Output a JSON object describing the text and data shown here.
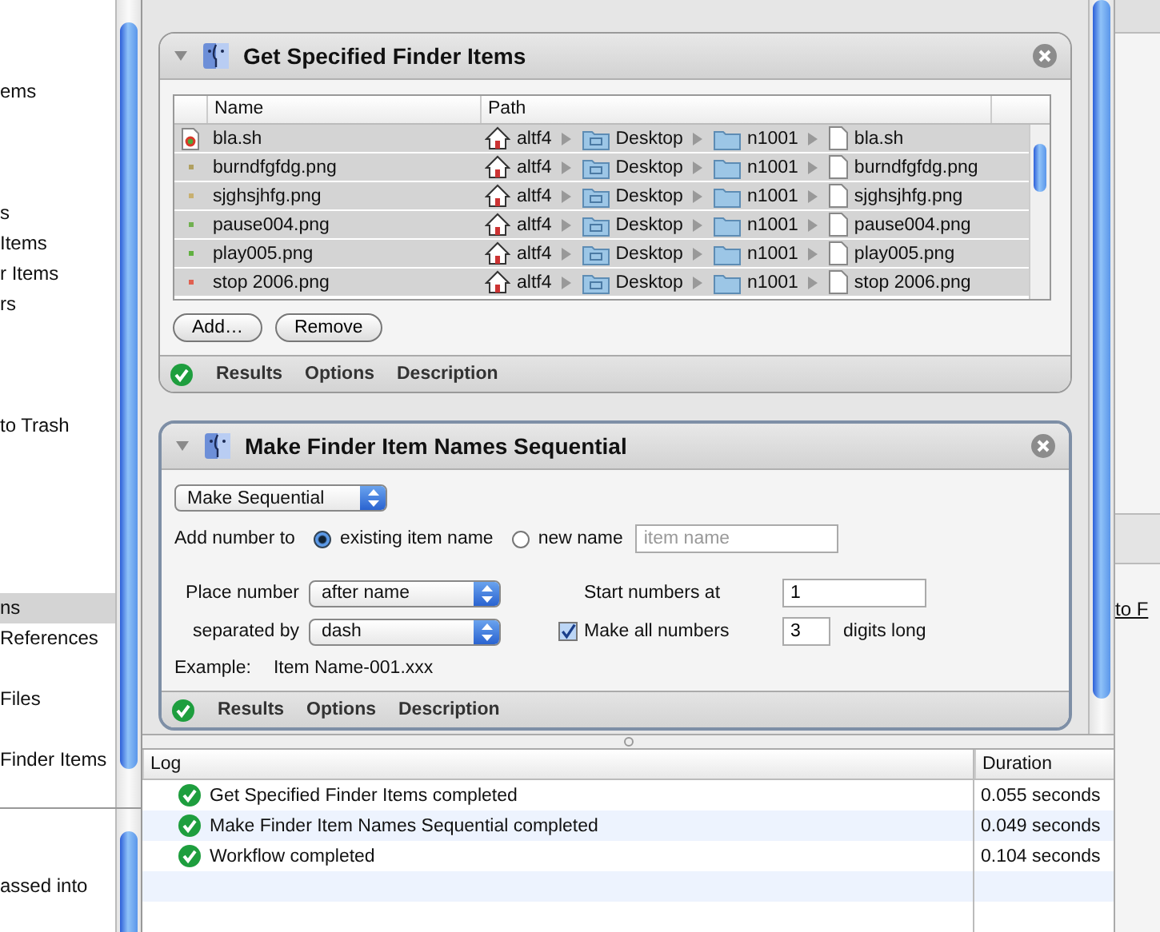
{
  "sidebar": {
    "items": [
      {
        "label": "ems",
        "selected": false
      },
      {
        "label": "s",
        "selected": false
      },
      {
        "label": "Items",
        "selected": false
      },
      {
        "label": "r Items",
        "selected": false
      },
      {
        "label": "rs",
        "selected": false
      },
      {
        "label": "to Trash",
        "selected": false
      },
      {
        "label": "ns",
        "selected": true
      },
      {
        "label": "References",
        "selected": false
      },
      {
        "label": "Files",
        "selected": false
      },
      {
        "label": "Finder Items",
        "selected": false
      }
    ],
    "description": "assed into"
  },
  "actions": [
    {
      "title": "Get Specified Finder Items",
      "expanded": true,
      "selected": false,
      "kind": "file_list",
      "table": {
        "columns": [
          "Name",
          "Path"
        ],
        "rows": [
          {
            "name": "bla.sh",
            "kind": "script",
            "selected": true,
            "path": [
              "altf4",
              "Desktop",
              "n1001",
              "bla.sh"
            ]
          },
          {
            "name": "burndfgfdg.png",
            "kind": "image",
            "color": "#b0a060",
            "selected": true,
            "path": [
              "altf4",
              "Desktop",
              "n1001",
              "burndfgfdg.png"
            ]
          },
          {
            "name": "sjghsjhfg.png",
            "kind": "image",
            "color": "#c8b070",
            "selected": true,
            "path": [
              "altf4",
              "Desktop",
              "n1001",
              "sjghsjhfg.png"
            ]
          },
          {
            "name": "pause004.png",
            "kind": "image",
            "color": "#70b050",
            "selected": true,
            "path": [
              "altf4",
              "Desktop",
              "n1001",
              "pause004.png"
            ]
          },
          {
            "name": "play005.png",
            "kind": "image",
            "color": "#60b040",
            "selected": true,
            "path": [
              "altf4",
              "Desktop",
              "n1001",
              "play005.png"
            ]
          },
          {
            "name": "stop 2006.png",
            "kind": "image",
            "color": "#e06050",
            "selected": true,
            "path": [
              "altf4",
              "Desktop",
              "n1001",
              "stop 2006.png"
            ]
          }
        ]
      },
      "buttons": [
        "Add…",
        "Remove"
      ],
      "footer": [
        "Results",
        "Options",
        "Description"
      ]
    },
    {
      "title": "Make Finder Item Names Sequential",
      "expanded": true,
      "selected": true,
      "kind": "rename",
      "mode": "Make Sequential",
      "add_number_label": "Add number to",
      "radios": [
        {
          "label": "existing item name",
          "selected": true
        },
        {
          "label": "new name",
          "selected": false
        }
      ],
      "new_name_placeholder": "item name",
      "place_label": "Place number",
      "place_value": "after name",
      "separator_label": "separated by",
      "separator_value": "dash",
      "start_label": "Start numbers at",
      "start_value": "1",
      "digits": {
        "checked": true,
        "label": "Make all numbers",
        "value": "3",
        "suffix": "digits long"
      },
      "example_label": "Example:",
      "example_value": "Item Name-001.xxx",
      "footer": [
        "Results",
        "Options",
        "Description"
      ]
    }
  ],
  "right_link": "to F",
  "log": {
    "columns": [
      "Log",
      "Duration"
    ],
    "rows": [
      {
        "text": "Get Specified Finder Items completed",
        "duration": "0.055 seconds"
      },
      {
        "text": "Make Finder Item Names Sequential completed",
        "duration": "0.049 seconds"
      },
      {
        "text": "Workflow completed",
        "duration": "0.104 seconds"
      }
    ]
  }
}
